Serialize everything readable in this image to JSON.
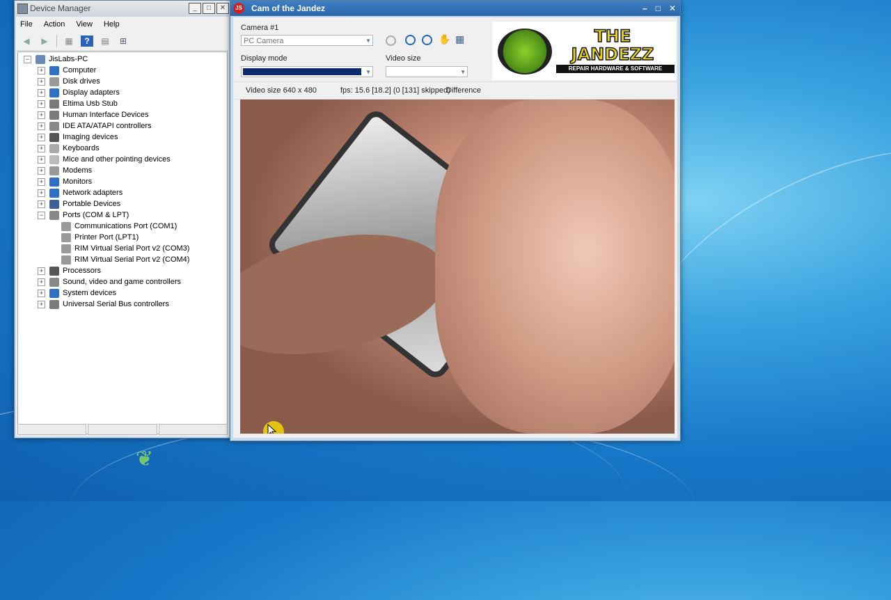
{
  "desktop": {
    "accent": "#1777c8"
  },
  "device_manager": {
    "title": "Device Manager",
    "title_buttons": [
      "_",
      "□",
      "✕"
    ],
    "menu": [
      "File",
      "Action",
      "View",
      "Help"
    ],
    "toolbar_icons": [
      "back-icon",
      "forward-icon",
      "properties-icon",
      "help-icon",
      "view-icon",
      "scan-hardware-icon"
    ],
    "root": "JisLabs-PC",
    "categories": [
      {
        "label": "Computer",
        "icon": "computer-icon",
        "color": "#2e6fc8"
      },
      {
        "label": "Disk drives",
        "icon": "disk-drive-icon",
        "color": "#9a9a9a"
      },
      {
        "label": "Display adapters",
        "icon": "display-adapter-icon",
        "color": "#2e6fc8"
      },
      {
        "label": "Eltima Usb Stub",
        "icon": "usb-icon",
        "color": "#7a7a7a"
      },
      {
        "label": "Human Interface Devices",
        "icon": "hid-icon",
        "color": "#7a7a7a"
      },
      {
        "label": "IDE ATA/ATAPI controllers",
        "icon": "ide-controller-icon",
        "color": "#888"
      },
      {
        "label": "Imaging devices",
        "icon": "camera-icon",
        "color": "#555"
      },
      {
        "label": "Keyboards",
        "icon": "keyboard-icon",
        "color": "#aaa"
      },
      {
        "label": "Mice and other pointing devices",
        "icon": "mouse-icon",
        "color": "#bbb"
      },
      {
        "label": "Modems",
        "icon": "modem-icon",
        "color": "#999"
      },
      {
        "label": "Monitors",
        "icon": "monitor-icon",
        "color": "#2e6fc8"
      },
      {
        "label": "Network adapters",
        "icon": "network-adapter-icon",
        "color": "#2e6fc8"
      },
      {
        "label": "Portable Devices",
        "icon": "portable-device-icon",
        "color": "#3a5f9a"
      },
      {
        "label": "Ports (COM & LPT)",
        "icon": "port-icon",
        "color": "#888"
      }
    ],
    "ports_children": [
      "Communications Port (COM1)",
      "Printer Port (LPT1)",
      "RIM Virtual Serial Port v2 (COM3)",
      "RIM Virtual Serial Port v2 (COM4)"
    ],
    "categories_after": [
      {
        "label": "Processors",
        "icon": "processor-icon",
        "color": "#555"
      },
      {
        "label": "Sound, video and game controllers",
        "icon": "speaker-icon",
        "color": "#888"
      },
      {
        "label": "System devices",
        "icon": "system-device-icon",
        "color": "#2e6fc8"
      },
      {
        "label": "Universal Serial Bus controllers",
        "icon": "usb-icon",
        "color": "#7a7a7a"
      }
    ]
  },
  "camera": {
    "title": "Cam of the Jandez",
    "title_buttons": [
      "–",
      "□",
      "✕"
    ],
    "camera_label": "Camera #1",
    "camera_value": "PC Camera",
    "display_mode_label": "Display mode",
    "display_mode_color": "#0d2a6e",
    "video_size_label": "Video size",
    "video_size_value": "",
    "controls": [
      "play-icon",
      "pause-icon",
      "stop-icon",
      "snapshot-hand-icon",
      "grid-settings-icon"
    ],
    "logo_main": "THE JANDEZZ",
    "logo_sub": "REPAIR HARDWARE & SOFTWARE",
    "status_size": "Video size 640 x 480",
    "status_fps": "fps: 15.6 [18.2] (0 [131] skipped)",
    "status_mode": "Difference"
  }
}
